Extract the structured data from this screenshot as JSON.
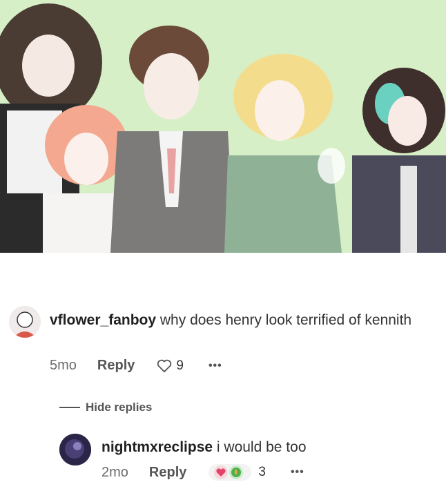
{
  "colors": {
    "artwork_bg": "#d8f0c8",
    "heart_react": "#e5426b",
    "fire_react": "#4caf50"
  },
  "comment1": {
    "username": "vflower_fanboy",
    "text": "why does henry look terrified of kennith",
    "time": "5mo",
    "reply_label": "Reply",
    "likes": "9",
    "more_label": "•••",
    "like_icon": "heart-icon"
  },
  "hide_replies_label": "Hide replies",
  "comment2": {
    "username": "nightmxreclipse",
    "text": "i would be too",
    "time": "2mo",
    "reply_label": "Reply",
    "reactions_count": "3",
    "more_label": "•••",
    "reaction_icons": [
      "heart-eyes-icon",
      "thumbs-up-icon"
    ]
  }
}
